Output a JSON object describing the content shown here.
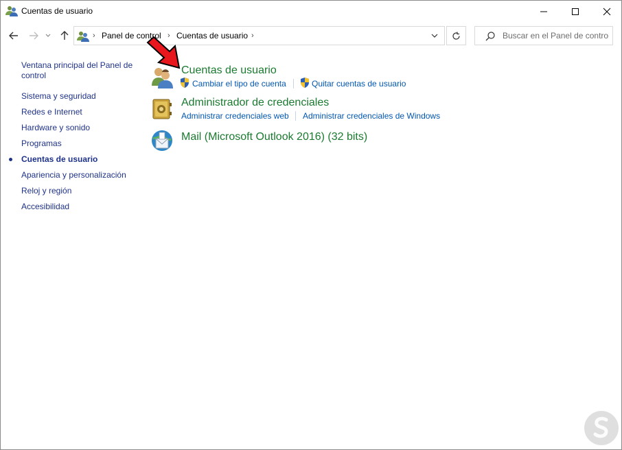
{
  "window": {
    "title": "Cuentas de usuario",
    "icon": "users-icon"
  },
  "address_bar": {
    "breadcrumb": [
      "Panel de control",
      "Cuentas de usuario"
    ]
  },
  "search": {
    "placeholder": "Buscar en el Panel de control"
  },
  "sidebar": {
    "home_link": "Ventana principal del Panel de control",
    "items": [
      {
        "label": "Sistema y seguridad",
        "current": false
      },
      {
        "label": "Redes e Internet",
        "current": false
      },
      {
        "label": "Hardware y sonido",
        "current": false
      },
      {
        "label": "Programas",
        "current": false
      },
      {
        "label": "Cuentas de usuario",
        "current": true
      },
      {
        "label": "Apariencia y personalización",
        "current": false
      },
      {
        "label": "Reloj y región",
        "current": false
      },
      {
        "label": "Accesibilidad",
        "current": false
      }
    ]
  },
  "categories": [
    {
      "title": "Cuentas de usuario",
      "icon": "user-accounts-icon",
      "links": [
        "Cambiar el tipo de cuenta",
        "Quitar cuentas de usuario"
      ]
    },
    {
      "title": "Administrador de credenciales",
      "icon": "credential-manager-icon",
      "links": [
        "Administrar credenciales web",
        "Administrar credenciales de Windows"
      ]
    },
    {
      "title": "Mail (Microsoft Outlook 2016) (32 bits)",
      "icon": "mail-icon",
      "links": []
    }
  ],
  "colors": {
    "category_title": "#1a7a2f",
    "link": "#0056b0",
    "sidebar_link": "#1e3287",
    "annotation_arrow": "#e8161d"
  }
}
